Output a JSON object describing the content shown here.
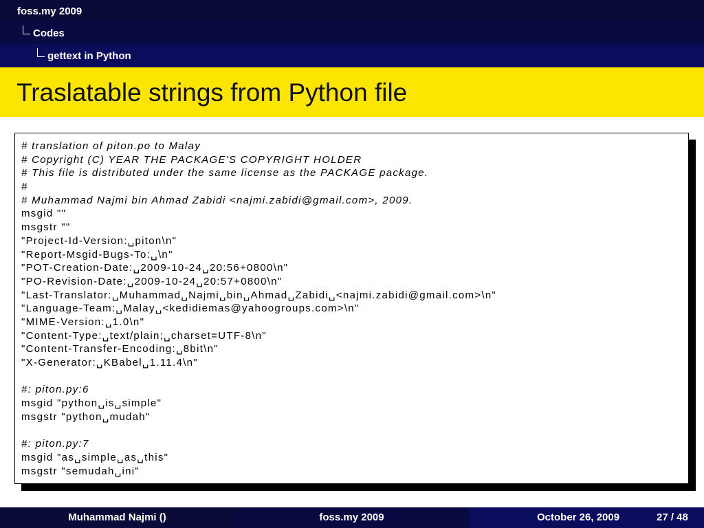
{
  "header": {
    "section": "foss.my 2009",
    "subsection": "Codes",
    "subsubsection": "gettext in Python"
  },
  "slide": {
    "title": "Traslatable strings from Python file"
  },
  "code": {
    "lines": [
      {
        "text": "# translation of piton.po to Malay",
        "kind": "comment"
      },
      {
        "text": "# Copyright (C) YEAR THE PACKAGE'S COPYRIGHT HOLDER",
        "kind": "comment"
      },
      {
        "text": "# This file is distributed under the same license as the PACKAGE package.",
        "kind": "comment"
      },
      {
        "text": "#",
        "kind": "comment"
      },
      {
        "text": "# Muhammad Najmi bin Ahmad Zabidi <najmi.zabidi@gmail.com>, 2009.",
        "kind": "comment"
      },
      {
        "text": "msgid \"\"",
        "kind": "code"
      },
      {
        "text": "msgstr \"\"",
        "kind": "code"
      },
      {
        "text": "\"Project-Id-Version:␣piton\\n\"",
        "kind": "code"
      },
      {
        "text": "\"Report-Msgid-Bugs-To:␣\\n\"",
        "kind": "code"
      },
      {
        "text": "\"POT-Creation-Date:␣2009-10-24␣20:56+0800\\n\"",
        "kind": "code"
      },
      {
        "text": "\"PO-Revision-Date:␣2009-10-24␣20:57+0800\\n\"",
        "kind": "code"
      },
      {
        "text": "\"Last-Translator:␣Muhammad␣Najmi␣bin␣Ahmad␣Zabidi␣<najmi.zabidi@gmail.com>\\n\"",
        "kind": "code"
      },
      {
        "text": "\"Language-Team:␣Malay␣<kedidiemas@yahoogroups.com>\\n\"",
        "kind": "code"
      },
      {
        "text": "\"MIME-Version:␣1.0\\n\"",
        "kind": "code"
      },
      {
        "text": "\"Content-Type:␣text/plain;␣charset=UTF-8\\n\"",
        "kind": "code"
      },
      {
        "text": "\"Content-Transfer-Encoding:␣8bit\\n\"",
        "kind": "code"
      },
      {
        "text": "\"X-Generator:␣KBabel␣1.11.4\\n\"",
        "kind": "code"
      },
      {
        "text": "",
        "kind": "blank"
      },
      {
        "text": "#: piton.py:6",
        "kind": "comment"
      },
      {
        "text": "msgid \"python␣is␣simple\"",
        "kind": "code"
      },
      {
        "text": "msgstr \"python␣mudah\"",
        "kind": "code"
      },
      {
        "text": "",
        "kind": "blank"
      },
      {
        "text": "#: piton.py:7",
        "kind": "comment"
      },
      {
        "text": "msgid \"as␣simple␣as␣this\"",
        "kind": "code"
      },
      {
        "text": "msgstr \"semudah␣ini\"",
        "kind": "code"
      }
    ]
  },
  "footer": {
    "author": "Muhammad Najmi ()",
    "event": "foss.my 2009",
    "date": "October 26, 2009",
    "page": "27 / 48"
  },
  "colors": {
    "header_dark": "#0b0b3a",
    "header_mid": "#0a0a42",
    "header_light": "#0c0c5c",
    "title_bar": "#fce500"
  }
}
